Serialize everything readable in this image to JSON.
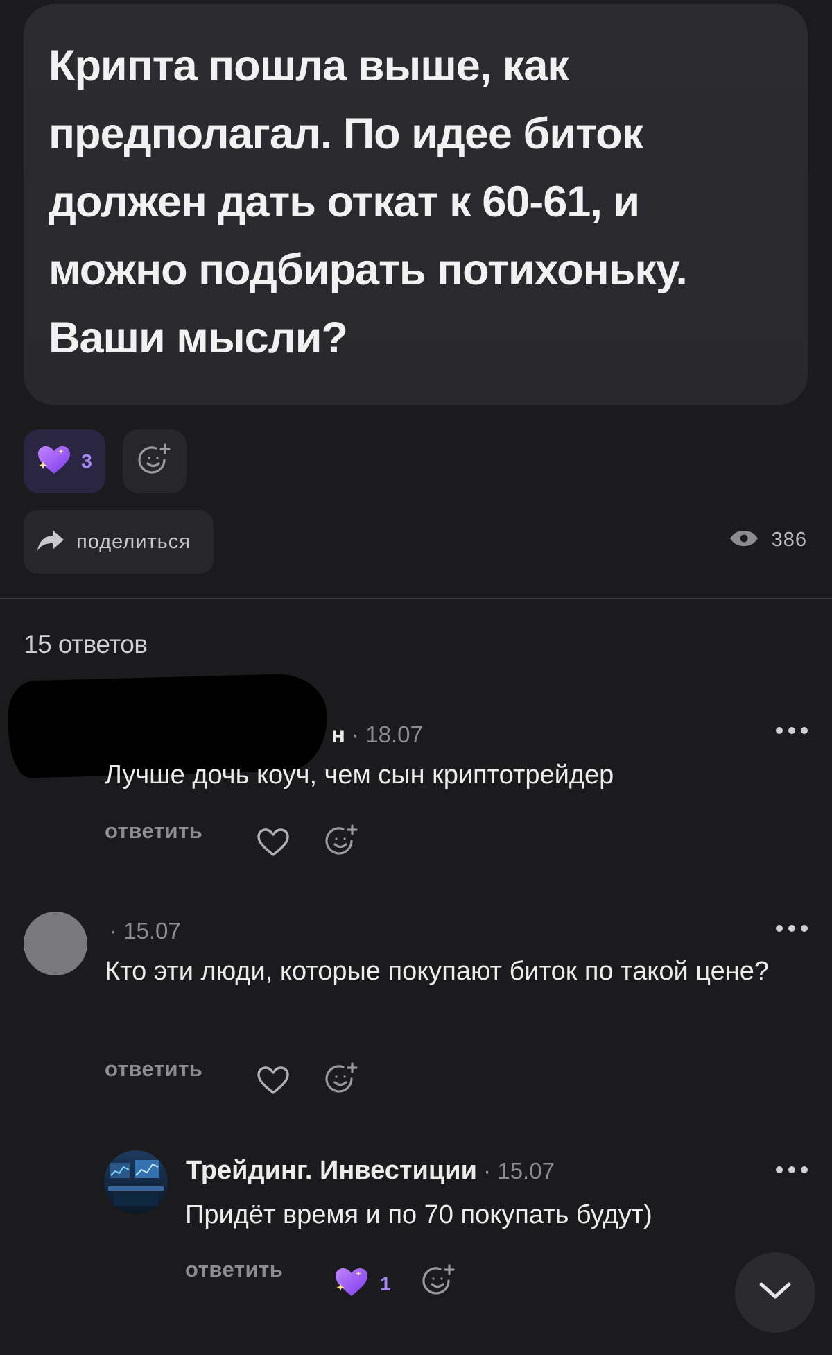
{
  "post": {
    "text": "Крипта пошла выше, как предполагал. По идее биток должен дать откат к 60-61, и можно подбирать потихоньку. Ваши мысли?",
    "reactions": [
      {
        "emoji": "sparkling-purple-heart",
        "count": "3"
      }
    ],
    "share_label": "поделиться",
    "views": "386"
  },
  "replies_count_label": "15 ответов",
  "comments": [
    {
      "author": "н",
      "date": "18.07",
      "text": "Лучше дочь коуч, чем сын криптотрейдер",
      "reply_label": "ответить"
    },
    {
      "author": "",
      "date": "15.07",
      "text": "Кто эти люди, которые покупают биток по такой цене?",
      "reply_label": "ответить"
    },
    {
      "author": "Трейдинг. Инвестиции",
      "date": "15.07",
      "text": "Придёт время и по 70 покупать будут)",
      "reply_label": "ответить",
      "reaction_count": "1"
    }
  ],
  "colors": {
    "background": "#1b1b1e",
    "card": "#2c2c30",
    "accent_purple": "#a78bfa",
    "muted": "#8d8d90"
  },
  "icons": {
    "reaction": "sparkling-heart-icon",
    "add_reaction": "smiley-plus-icon",
    "share": "share-arrow-icon",
    "views": "eye-icon",
    "like": "heart-outline-icon",
    "more": "more-dots-icon",
    "scroll": "chevron-down-icon"
  }
}
